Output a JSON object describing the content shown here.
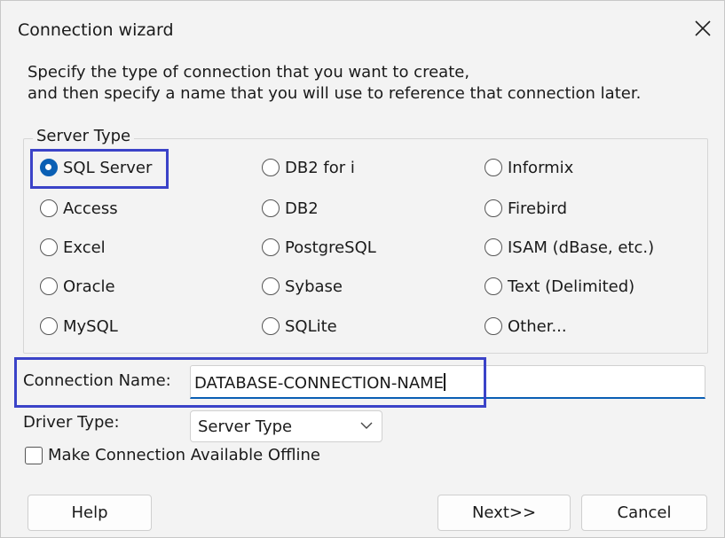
{
  "window": {
    "title": "Connection wizard"
  },
  "intro": {
    "line1": "Specify the type of connection that you want to create,",
    "line2": "and then specify a name that you will use to reference that connection later."
  },
  "server_type": {
    "legend": "Server Type",
    "selected": "SQL Server",
    "options": [
      "SQL Server",
      "Access",
      "Excel",
      "Oracle",
      "MySQL",
      "DB2 for i",
      "DB2",
      "PostgreSQL",
      "Sybase",
      "SQLite",
      "Informix",
      "Firebird",
      "ISAM (dBase, etc.)",
      "Text (Delimited)",
      "Other..."
    ]
  },
  "connection_name": {
    "label": "Connection Name:",
    "value": "DATABASE-CONNECTION-NAME"
  },
  "driver_type": {
    "label": "Driver Type:",
    "value": "Server Type"
  },
  "offline": {
    "label": "Make Connection Available Offline",
    "checked": false
  },
  "buttons": {
    "help": "Help",
    "next": "Next>>",
    "cancel": "Cancel"
  },
  "colors": {
    "accent": "#0a5fb4",
    "highlight": "#3b43c8",
    "background": "#f3f3f3"
  },
  "icons": {
    "close": "close-icon",
    "dropdown": "chevron-down-icon"
  }
}
